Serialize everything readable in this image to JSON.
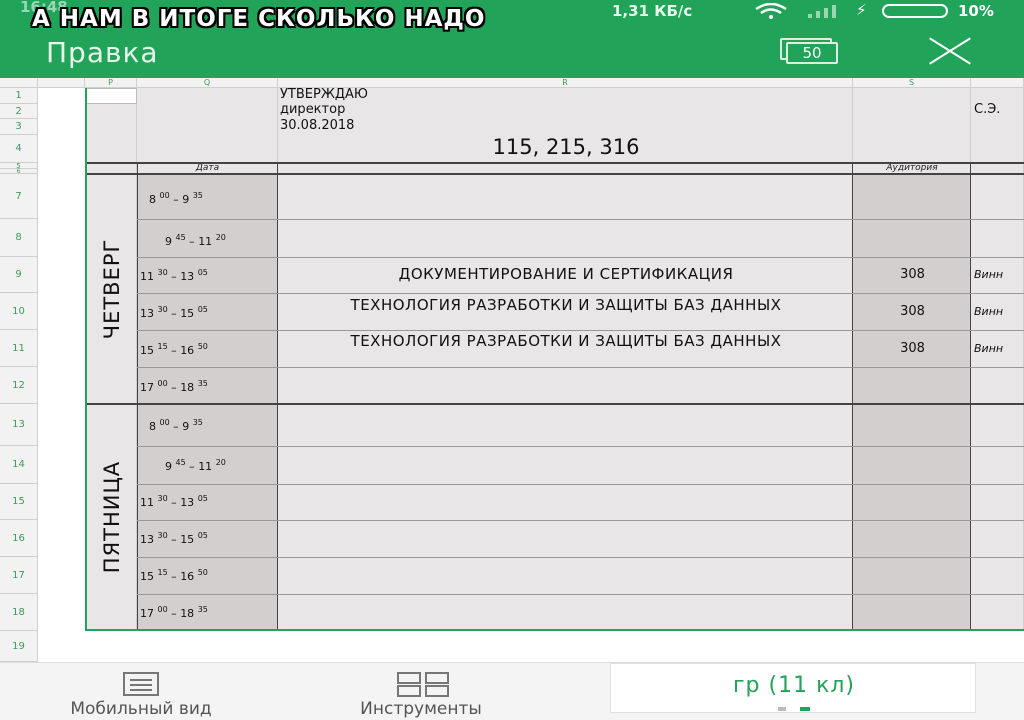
{
  "status": {
    "time": "16:48",
    "speed": "1,31 КБ/с",
    "battery": "10%"
  },
  "overlay_caption": "А НАМ В ИТОГЕ СКОЛЬКО НАДО",
  "toolbar": {
    "title": "Правка",
    "sheets_count": "50"
  },
  "columns": [
    "P",
    "Q",
    "R",
    "S"
  ],
  "rows": [
    "1",
    "2",
    "3",
    "4",
    "5",
    "6",
    "7",
    "8",
    "9",
    "10",
    "11",
    "12",
    "13",
    "14",
    "15",
    "16",
    "17",
    "18",
    "19"
  ],
  "header": {
    "approve": "УТВЕРЖДАЮ",
    "position": "директор",
    "date": "30.08.2018",
    "signature": "С.Э.",
    "groups": "115, 215, 316",
    "col_date": "Дата",
    "col_room": "Аудитория"
  },
  "days": [
    {
      "name": "ЧЕТВЕРГ",
      "slots": [
        {
          "start_h": "8",
          "start_m": "00",
          "end_h": "9",
          "end_m": "35",
          "subject": "",
          "room": "",
          "teacher": ""
        },
        {
          "start_h": "9",
          "start_m": "45",
          "end_h": "11",
          "end_m": "20",
          "subject": "",
          "room": "",
          "teacher": ""
        },
        {
          "start_h": "11",
          "start_m": "30",
          "end_h": "13",
          "end_m": "05",
          "subject": "ДОКУМЕНТИРОВАНИЕ И СЕРТИФИКАЦИЯ",
          "room": "308",
          "teacher": "Винн"
        },
        {
          "start_h": "13",
          "start_m": "30",
          "end_h": "15",
          "end_m": "05",
          "subject": "ТЕХНОЛОГИЯ РАЗРАБОТКИ И ЗАЩИТЫ БАЗ ДАННЫХ",
          "room": "308",
          "teacher": "Винн"
        },
        {
          "start_h": "15",
          "start_m": "15",
          "end_h": "16",
          "end_m": "50",
          "subject": "ТЕХНОЛОГИЯ РАЗРАБОТКИ И ЗАЩИТЫ БАЗ ДАННЫХ",
          "room": "308",
          "teacher": "Винн"
        },
        {
          "start_h": "17",
          "start_m": "00",
          "end_h": "18",
          "end_m": "35",
          "subject": "",
          "room": "",
          "teacher": ""
        }
      ]
    },
    {
      "name": "ПЯТНИЦА",
      "slots": [
        {
          "start_h": "8",
          "start_m": "00",
          "end_h": "9",
          "end_m": "35",
          "subject": "",
          "room": "",
          "teacher": ""
        },
        {
          "start_h": "9",
          "start_m": "45",
          "end_h": "11",
          "end_m": "20",
          "subject": "",
          "room": "",
          "teacher": ""
        },
        {
          "start_h": "11",
          "start_m": "30",
          "end_h": "13",
          "end_m": "05",
          "subject": "",
          "room": "",
          "teacher": ""
        },
        {
          "start_h": "13",
          "start_m": "30",
          "end_h": "15",
          "end_m": "05",
          "subject": "",
          "room": "",
          "teacher": ""
        },
        {
          "start_h": "15",
          "start_m": "15",
          "end_h": "16",
          "end_m": "50",
          "subject": "",
          "room": "",
          "teacher": ""
        },
        {
          "start_h": "17",
          "start_m": "00",
          "end_h": "18",
          "end_m": "35",
          "subject": "",
          "room": "",
          "teacher": ""
        }
      ]
    }
  ],
  "bottom_nav": {
    "mobile_view": "Мобильный вид",
    "tools": "Инструменты",
    "sheet_tab": "гр (11 кл)"
  },
  "colors": {
    "accent": "#21a35a"
  }
}
